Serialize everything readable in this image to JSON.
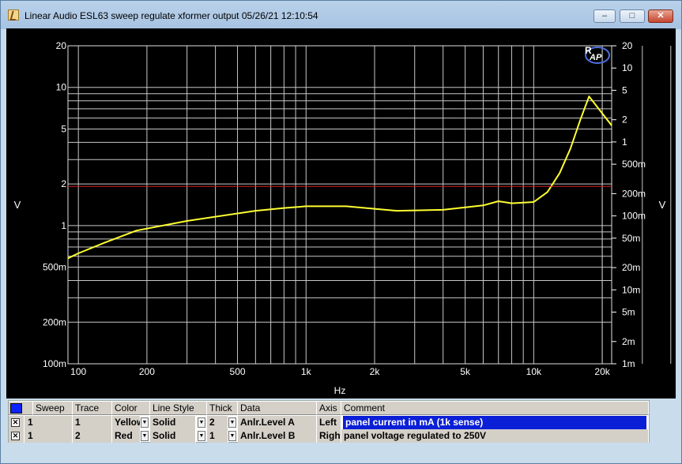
{
  "window": {
    "title": "Linear Audio  ESL63 sweep regulate xformer output  05/26/21 12:10:54",
    "minimize_glyph": "–",
    "maximize_glyph": "□",
    "close_glyph": "✕"
  },
  "chart_data": {
    "type": "line",
    "xlabel": "Hz",
    "ylabel_left": "V",
    "ylabel_right": "V",
    "x_scale": "log",
    "xlim": [
      90,
      22000
    ],
    "x_ticks": [
      {
        "value": 100,
        "label": "100"
      },
      {
        "value": 200,
        "label": "200"
      },
      {
        "value": 500,
        "label": "500"
      },
      {
        "value": 1000,
        "label": "1k"
      },
      {
        "value": 2000,
        "label": "2k"
      },
      {
        "value": 5000,
        "label": "5k"
      },
      {
        "value": 10000,
        "label": "10k"
      },
      {
        "value": 20000,
        "label": "20k"
      }
    ],
    "left_axis": {
      "scale": "log",
      "ylim": [
        0.1,
        20
      ],
      "ticks": [
        {
          "value": 20,
          "label": "20"
        },
        {
          "value": 10,
          "label": "10"
        },
        {
          "value": 5,
          "label": "5"
        },
        {
          "value": 2,
          "label": "2"
        },
        {
          "value": 1,
          "label": "1"
        },
        {
          "value": 0.5,
          "label": "500m"
        },
        {
          "value": 0.2,
          "label": "200m"
        },
        {
          "value": 0.1,
          "label": "100m"
        }
      ]
    },
    "right_axis": {
      "scale": "log",
      "ylim": [
        0.001,
        20
      ],
      "ticks": [
        {
          "value": 20,
          "label": "20"
        },
        {
          "value": 10,
          "label": "10"
        },
        {
          "value": 5,
          "label": "5"
        },
        {
          "value": 2,
          "label": "2"
        },
        {
          "value": 1,
          "label": "1"
        },
        {
          "value": 0.5,
          "label": "500m"
        },
        {
          "value": 0.2,
          "label": "200m"
        },
        {
          "value": 0.1,
          "label": "100m"
        },
        {
          "value": 0.05,
          "label": "50m"
        },
        {
          "value": 0.02,
          "label": "20m"
        },
        {
          "value": 0.01,
          "label": "10m"
        },
        {
          "value": 0.005,
          "label": "5m"
        },
        {
          "value": 0.002,
          "label": "2m"
        },
        {
          "value": 0.001,
          "label": "1m"
        }
      ]
    },
    "grid": true,
    "series": [
      {
        "color": "#ffff33",
        "axis": "left",
        "x": [
          90,
          100,
          130,
          180,
          300,
          600,
          800,
          1000,
          1500,
          2500,
          4000,
          6000,
          7000,
          8000,
          10000,
          11500,
          13000,
          14500,
          16000,
          17500,
          22000
        ],
        "y": [
          0.58,
          0.63,
          0.75,
          0.92,
          1.08,
          1.28,
          1.34,
          1.38,
          1.38,
          1.28,
          1.3,
          1.4,
          1.5,
          1.45,
          1.48,
          1.75,
          2.4,
          3.6,
          5.8,
          8.6,
          5.3
        ]
      },
      {
        "color": "#d02020",
        "axis": "right",
        "x": [
          90,
          22000
        ],
        "y": [
          0.25,
          0.25
        ]
      }
    ]
  },
  "logo": {
    "letter": "R",
    "text": "AP"
  },
  "legend": {
    "headers": [
      "Sweep",
      "Trace",
      "Color",
      "Line Style",
      "Thick",
      "Data",
      "Axis",
      "Comment"
    ],
    "rows": [
      {
        "checked": "✕",
        "sweep": "1",
        "trace": "1",
        "color": "Yellow",
        "style": "Solid",
        "thick": "2",
        "data": "Anlr.Level A",
        "axis": "Left",
        "comment": "panel current in mA (1k sense)"
      },
      {
        "checked": "✕",
        "sweep": "1",
        "trace": "2",
        "color": "Red",
        "style": "Solid",
        "thick": "1",
        "data": "Anlr.Level B",
        "axis": "Right",
        "comment": "panel voltage regulated to 250V"
      }
    ]
  }
}
